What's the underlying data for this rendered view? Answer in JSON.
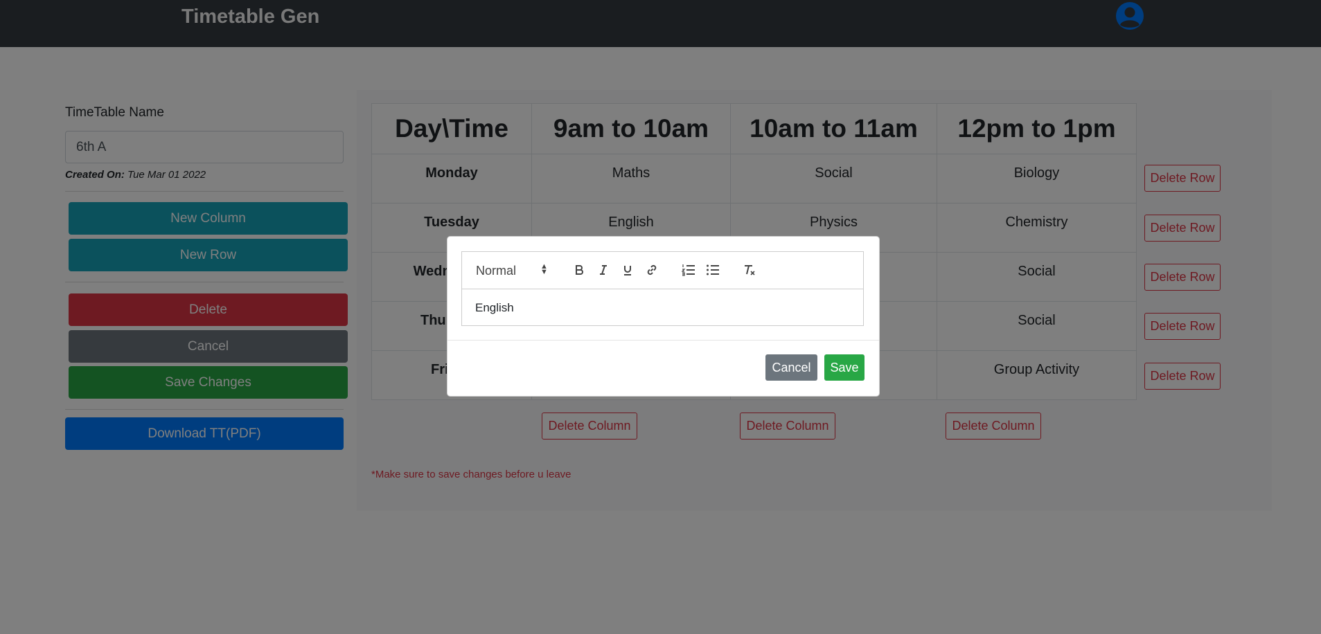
{
  "app": {
    "title": "Timetable Gen",
    "accent": "#007bff",
    "navbar_bg": "#343a40"
  },
  "sidebar": {
    "name_label": "TimeTable Name",
    "name_value": "6th A",
    "created_label": "Created On:",
    "created_value": "Tue Mar 01 2022",
    "new_column": "New Column",
    "new_row": "New Row",
    "delete": "Delete",
    "cancel": "Cancel",
    "save_changes": "Save Changes",
    "download": "Download TT(PDF)"
  },
  "table": {
    "headers": [
      "Day\\Time",
      "9am to 10am",
      "10am to 11am",
      "12pm to 1pm"
    ],
    "rows": [
      {
        "day": "Monday",
        "cells": [
          "Maths",
          "Social",
          "Biology"
        ]
      },
      {
        "day": "Tuesday",
        "cells": [
          "English",
          "Physics",
          "Chemistry"
        ]
      },
      {
        "day": "Wednesday",
        "cells": [
          "",
          "",
          "Social"
        ]
      },
      {
        "day": "Thursday",
        "cells": [
          "",
          "",
          "Social"
        ]
      },
      {
        "day": "Friday",
        "cells": [
          "",
          "",
          "Group Activity"
        ]
      }
    ],
    "delete_row_label": "Delete Row",
    "delete_column_label": "Delete Column",
    "note": "*Make sure to save changes before u leave"
  },
  "modal": {
    "format_select": "Normal",
    "content": "English",
    "cancel": "Cancel",
    "save": "Save"
  }
}
